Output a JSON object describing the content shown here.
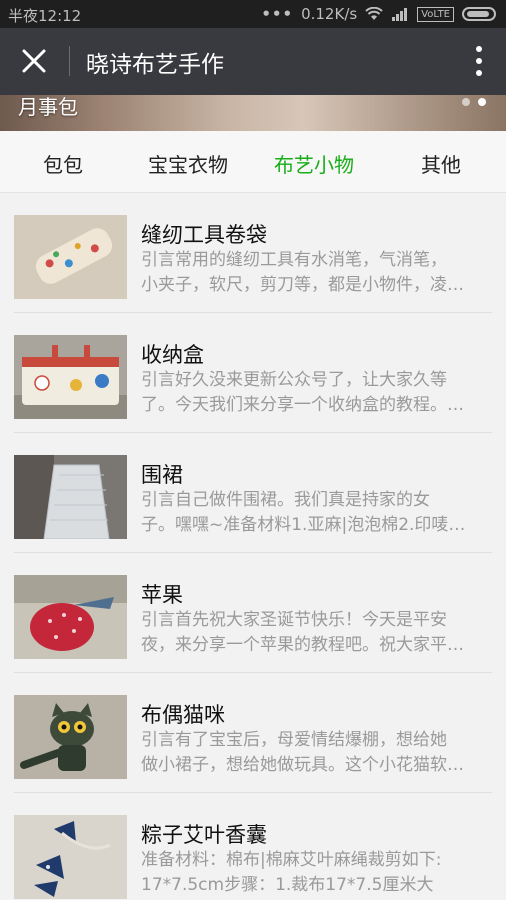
{
  "status_bar": {
    "time": "半夜12:12",
    "signal_dots": "•••",
    "speed": "0.12K/s",
    "volte": "VoLTE",
    "icons": [
      "wifi-icon",
      "cell-signal-icon",
      "battery-icon"
    ]
  },
  "app_bar": {
    "title": "晓诗布艺手作",
    "close_icon": "close-icon",
    "more_icon": "more-vertical-icon"
  },
  "banner": {
    "label": "月事包"
  },
  "tabs": [
    {
      "label": "包包",
      "active": false
    },
    {
      "label": "宝宝衣物",
      "active": false
    },
    {
      "label": "布艺小物",
      "active": true
    },
    {
      "label": "其他",
      "active": false
    }
  ],
  "colors": {
    "accent_green": "#1aad19",
    "app_bar_bg": "#393a3f",
    "status_bar_bg": "#1f1f1f",
    "desc_gray": "#9a9a9a"
  },
  "articles": [
    {
      "title": "缝纫工具卷袋",
      "desc1": "引言常用的缝纫工具有水消笔，气消笔，",
      "desc2": "小夹子，软尺，剪刀等，都是小物件，凌…"
    },
    {
      "title": "收纳盒",
      "desc1": "引言好久没来更新公众号了，让大家久等",
      "desc2": "了。今天我们来分享一个收纳盒的教程。…"
    },
    {
      "title": "围裙",
      "desc1": "引言自己做件围裙。我们真是持家的女",
      "desc2": "子。嘿嘿~准备材料1.亚麻|泡泡棉2.印唛…"
    },
    {
      "title": "苹果",
      "desc1": "引言首先祝大家圣诞节快乐！今天是平安",
      "desc2": "夜，来分享一个苹果的教程吧。祝大家平…"
    },
    {
      "title": "布偶猫咪",
      "desc1": "引言有了宝宝后，母爱情结爆棚，想给她",
      "desc2": "做小裙子，想给她做玩具。这个小花猫软…"
    },
    {
      "title": "粽子艾叶香囊",
      "desc1": "准备材料：棉布|棉麻艾叶麻绳裁剪如下:",
      "desc2": "17*7.5cm步骤：1.裁布17*7.5厘米大小。…"
    }
  ]
}
